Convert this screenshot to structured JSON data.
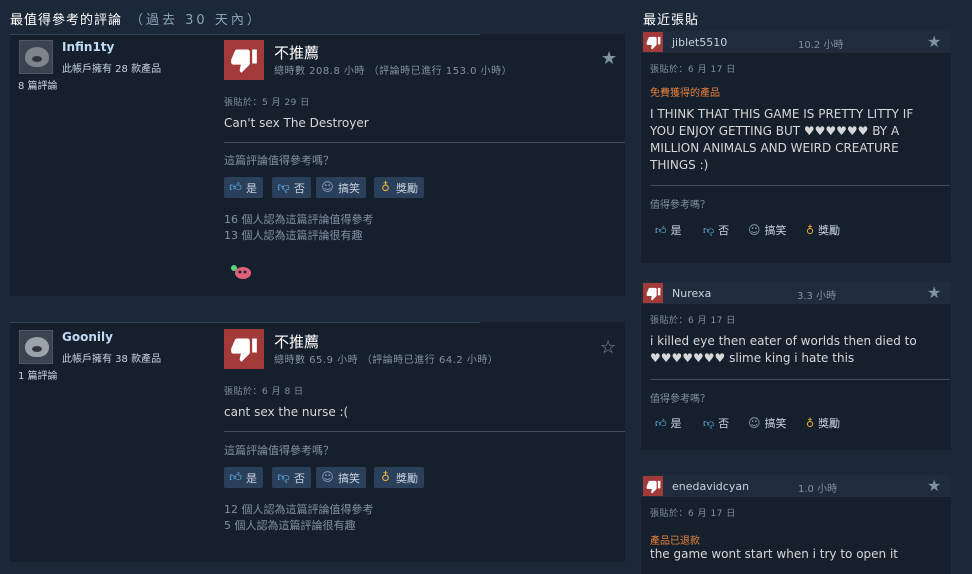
{
  "header": {
    "top_reviews_title": "最值得參考的評論",
    "top_reviews_period": "（過去 30 天內）",
    "recent_posts_title": "最近張貼"
  },
  "icons": {
    "thumbs_down": "thumbs-down-icon",
    "star": "star-icon",
    "thumbs_up": "thumbs-up-icon",
    "funny": "smiley-icon",
    "award": "award-icon"
  },
  "colors": {
    "background": "#1b2838",
    "card": "#16202d",
    "not_recommended": "#a23a3a",
    "link_blue": "#66c0f4",
    "refund_orange": "#e8813a"
  },
  "reviews": [
    {
      "username": "Infin1ty",
      "owns": "此帳戶擁有 28 款產品",
      "review_count": "8 篇評論",
      "verdict": "不推薦",
      "hours": "總時數 208.8 小時 （評論時已進行 153.0 小時）",
      "posted": "張貼於：5 月 29 日",
      "text": "Can't sex The Destroyer",
      "helpful_q": "這篇評論值得參考嗎？",
      "buttons": {
        "yes": "是",
        "no": "否",
        "funny": "搞笑",
        "award": "獎勵"
      },
      "helpful_stat": "16 個人認為這篇評論值得參考",
      "funny_stat": "13 個人認為這篇評論很有趣"
    },
    {
      "username": "Goonily",
      "owns": "此帳戶擁有 38 款產品",
      "review_count": "1 篇評論",
      "verdict": "不推薦",
      "hours": "總時數 65.9 小時 （評論時已進行 64.2 小時）",
      "posted": "張貼於：6 月 8 日",
      "text": "cant sex the nurse :(",
      "helpful_q": "這篇評論值得參考嗎？",
      "buttons": {
        "yes": "是",
        "no": "否",
        "funny": "搞笑",
        "award": "獎勵"
      },
      "helpful_stat": "12 個人認為這篇評論值得參考",
      "funny_stat": "5 個人認為這篇評論很有趣"
    }
  ],
  "recent_posts": [
    {
      "author": "jiblet5510",
      "hours": "10.2 小時",
      "posted": "張貼於：6 月 17 日",
      "tag": "免費獲得的產品",
      "text": "I THINK THAT THIS GAME IS PRETTY LITTY IF YOU ENJOY GETTING BUT ♥♥♥♥♥♥ BY A MILLION ANIMALS AND WEIRD CREATURE THINGS :)",
      "helpful_q": "值得參考嗎？",
      "buttons": {
        "yes": "是",
        "no": "否",
        "funny": "搞笑",
        "award": "獎勵"
      }
    },
    {
      "author": "Nurexa",
      "hours": "3.3 小時",
      "posted": "張貼於：6 月 17 日",
      "tag": "",
      "text": "i killed eye then eater of worlds then died to ♥♥♥♥♥♥♥ slime king i hate this",
      "helpful_q": "值得參考嗎？",
      "buttons": {
        "yes": "是",
        "no": "否",
        "funny": "搞笑",
        "award": "獎勵"
      }
    },
    {
      "author": "enedavidcyan",
      "hours": "1.0 小時",
      "posted": "張貼於：6 月 17 日",
      "tag": "產品已退款",
      "text": "the game wont start when i try to open it",
      "helpful_q": "",
      "buttons": {}
    }
  ]
}
